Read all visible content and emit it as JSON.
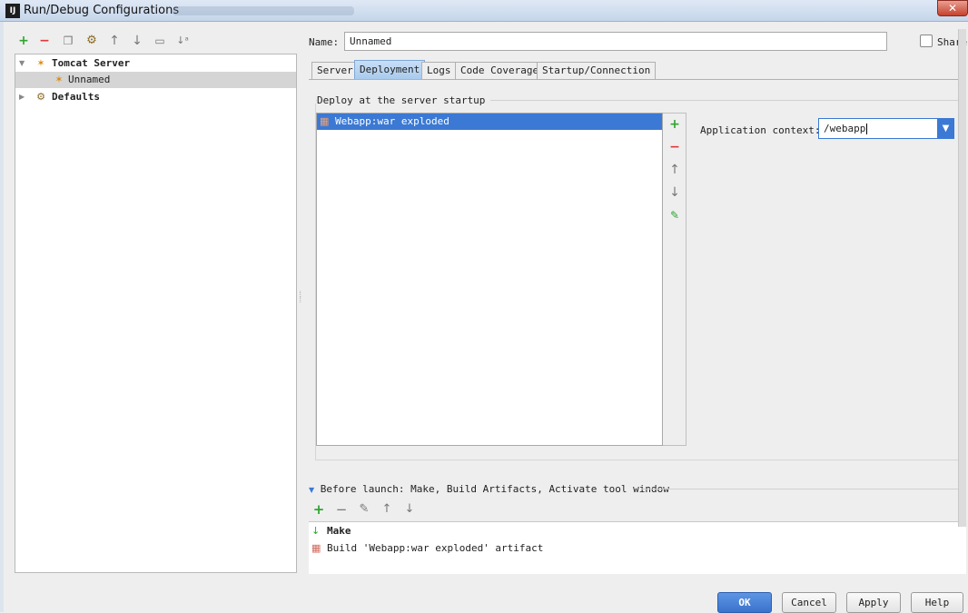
{
  "window": {
    "title": "Run/Debug Configurations",
    "app_icon": "IJ",
    "close": "✕"
  },
  "toolbar": {
    "icons": [
      "add-icon",
      "remove-icon",
      "copy-icon",
      "edit-defaults-icon",
      "move-up-icon",
      "move-down-icon",
      "folder-icon",
      "sort-icon"
    ]
  },
  "tree": {
    "items": [
      {
        "label": "Tomcat Server",
        "expanded": true,
        "bold": true
      },
      {
        "label": "Unnamed",
        "selected": true
      },
      {
        "label": "Defaults",
        "expanded": false,
        "bold": true
      }
    ]
  },
  "name_field": {
    "label": "Name:",
    "value": "Unnamed"
  },
  "share": {
    "label": "Share",
    "checked": false
  },
  "tabs": [
    {
      "label": "Server",
      "active": false
    },
    {
      "label": "Deployment",
      "active": true
    },
    {
      "label": "Logs",
      "active": false
    },
    {
      "label": "Code Coverage",
      "active": false
    },
    {
      "label": "Startup/Connection",
      "active": false
    }
  ],
  "deployment": {
    "section_title": "Deploy at the server startup",
    "items": [
      "Webapp:war exploded"
    ],
    "side_buttons": [
      "add-icon",
      "remove-icon",
      "move-up-icon",
      "move-down-icon",
      "edit-icon"
    ]
  },
  "app_context": {
    "label": "Application context:",
    "value": "/webapp"
  },
  "before_launch": {
    "title": "Before launch: Make, Build Artifacts, Activate tool window",
    "items": [
      "Make",
      "Build 'Webapp:war exploded' artifact"
    ]
  },
  "buttons": {
    "ok": "OK",
    "cancel": "Cancel",
    "apply": "Apply",
    "help": "Help"
  },
  "colors": {
    "accent": "#3b79d4",
    "add": "#2fa52f",
    "remove": "#e0373a"
  }
}
